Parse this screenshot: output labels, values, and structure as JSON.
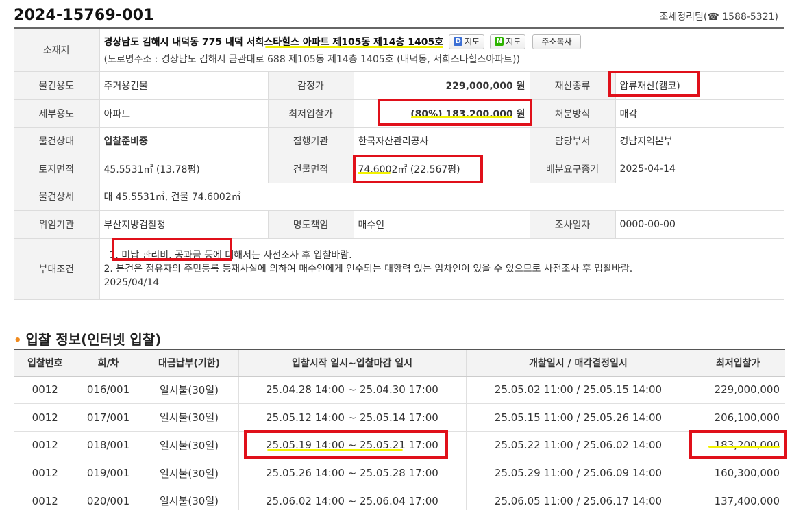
{
  "header": {
    "case_number": "2024-15769-001",
    "team_label": "조세정리팀",
    "phone_icon": "phone-icon",
    "phone_glyph": "☎",
    "phone_number": "1588-5321"
  },
  "detail": {
    "location": {
      "label": "소재지",
      "address": "경상남도 김해시 내덕동 775 내덕 서희스타힐스 아파트 제105동 제14층 1405호",
      "road_address": "(도로명주소 : 경상남도 김해시 금관대로 688 제105동 제14층 1405호 (내덕동, 서희스타힐스아파트))",
      "kakao_map_logo": "D",
      "kakao_map_label": "지도",
      "naver_map_logo": "N",
      "naver_map_label": "지도",
      "copy_label": "주소복사"
    },
    "rows": {
      "usage_label": "물건용도",
      "usage_value": "주거용건물",
      "appraisal_label": "감정가",
      "appraisal_value": "229,000,000 원",
      "asset_type_label": "재산종류",
      "asset_type_value": "압류재산(캠코)",
      "sub_usage_label": "세부용도",
      "sub_usage_value": "아파트",
      "min_bid_label": "최저입찰가",
      "min_bid_value": "(80%) 183,200,000 원",
      "disposal_label": "처분방식",
      "disposal_value": "매각",
      "status_label": "물건상태",
      "status_value": "입찰준비중",
      "agency_label": "집행기관",
      "agency_value": "한국자산관리공사",
      "dept_label": "담당부서",
      "dept_value": "경남지역본부",
      "land_area_label": "토지면적",
      "land_area_value": "45.5531㎡ (13.78평)",
      "building_area_label": "건물면적",
      "building_area_value": "74.6002㎡ (22.567평)",
      "deadline_label": "배분요구종기",
      "deadline_value": "2025-04-14",
      "item_detail_label": "물건상세",
      "item_detail_value": "대 45.5531㎡, 건물 74.6002㎡",
      "delegator_label": "위임기관",
      "delegator_value": "부산지방검찰청",
      "transfer_label": "명도책임",
      "transfer_value": "매수인",
      "survey_label": "조사일자",
      "survey_value": "0000-00-00",
      "conditions_label": "부대조건",
      "condition_1": "1. 미납 관리비, 공과금 등에 대해서는 사전조사 후 입찰바람.",
      "condition_2": "2. 본건은 점유자의 주민등록 등재사실에 의하여 매수인에게 인수되는 대항력 있는 임차인이 있을 수 있으므로 사전조사 후 입찰바람.",
      "condition_3": "2025/04/14"
    }
  },
  "bid_section": {
    "title": "입찰 정보(인터넷 입찰)",
    "columns": [
      "입찰번호",
      "회/차",
      "대금납부(기한)",
      "입찰시작 일시~입찰마감 일시",
      "개찰일시 / 매각결정일시",
      "최저입찰가"
    ],
    "rows": [
      [
        "0012",
        "016/001",
        "일시불(30일)",
        "25.04.28 14:00 ~ 25.04.30 17:00",
        "25.05.02 11:00 / 25.05.15 14:00",
        "229,000,000"
      ],
      [
        "0012",
        "017/001",
        "일시불(30일)",
        "25.05.12 14:00 ~ 25.05.14 17:00",
        "25.05.15 11:00 / 25.05.26 14:00",
        "206,100,000"
      ],
      [
        "0012",
        "018/001",
        "일시불(30일)",
        "25.05.19 14:00 ~ 25.05.21 17:00",
        "25.05.22 11:00 / 25.06.02 14:00",
        "183,200,000"
      ],
      [
        "0012",
        "019/001",
        "일시불(30일)",
        "25.05.26 14:00 ~ 25.05.28 17:00",
        "25.05.29 11:00 / 25.06.09 14:00",
        "160,300,000"
      ],
      [
        "0012",
        "020/001",
        "일시불(30일)",
        "25.06.02 14:00 ~ 25.06.04 17:00",
        "25.06.05 11:00 / 25.06.17 14:00",
        "137,400,000"
      ]
    ]
  },
  "colors": {
    "accent_orange": "#f08a1d",
    "price_blue": "#2a6ab4",
    "annotation_red": "#e0101a",
    "annotation_highlight": "#f2f200"
  }
}
